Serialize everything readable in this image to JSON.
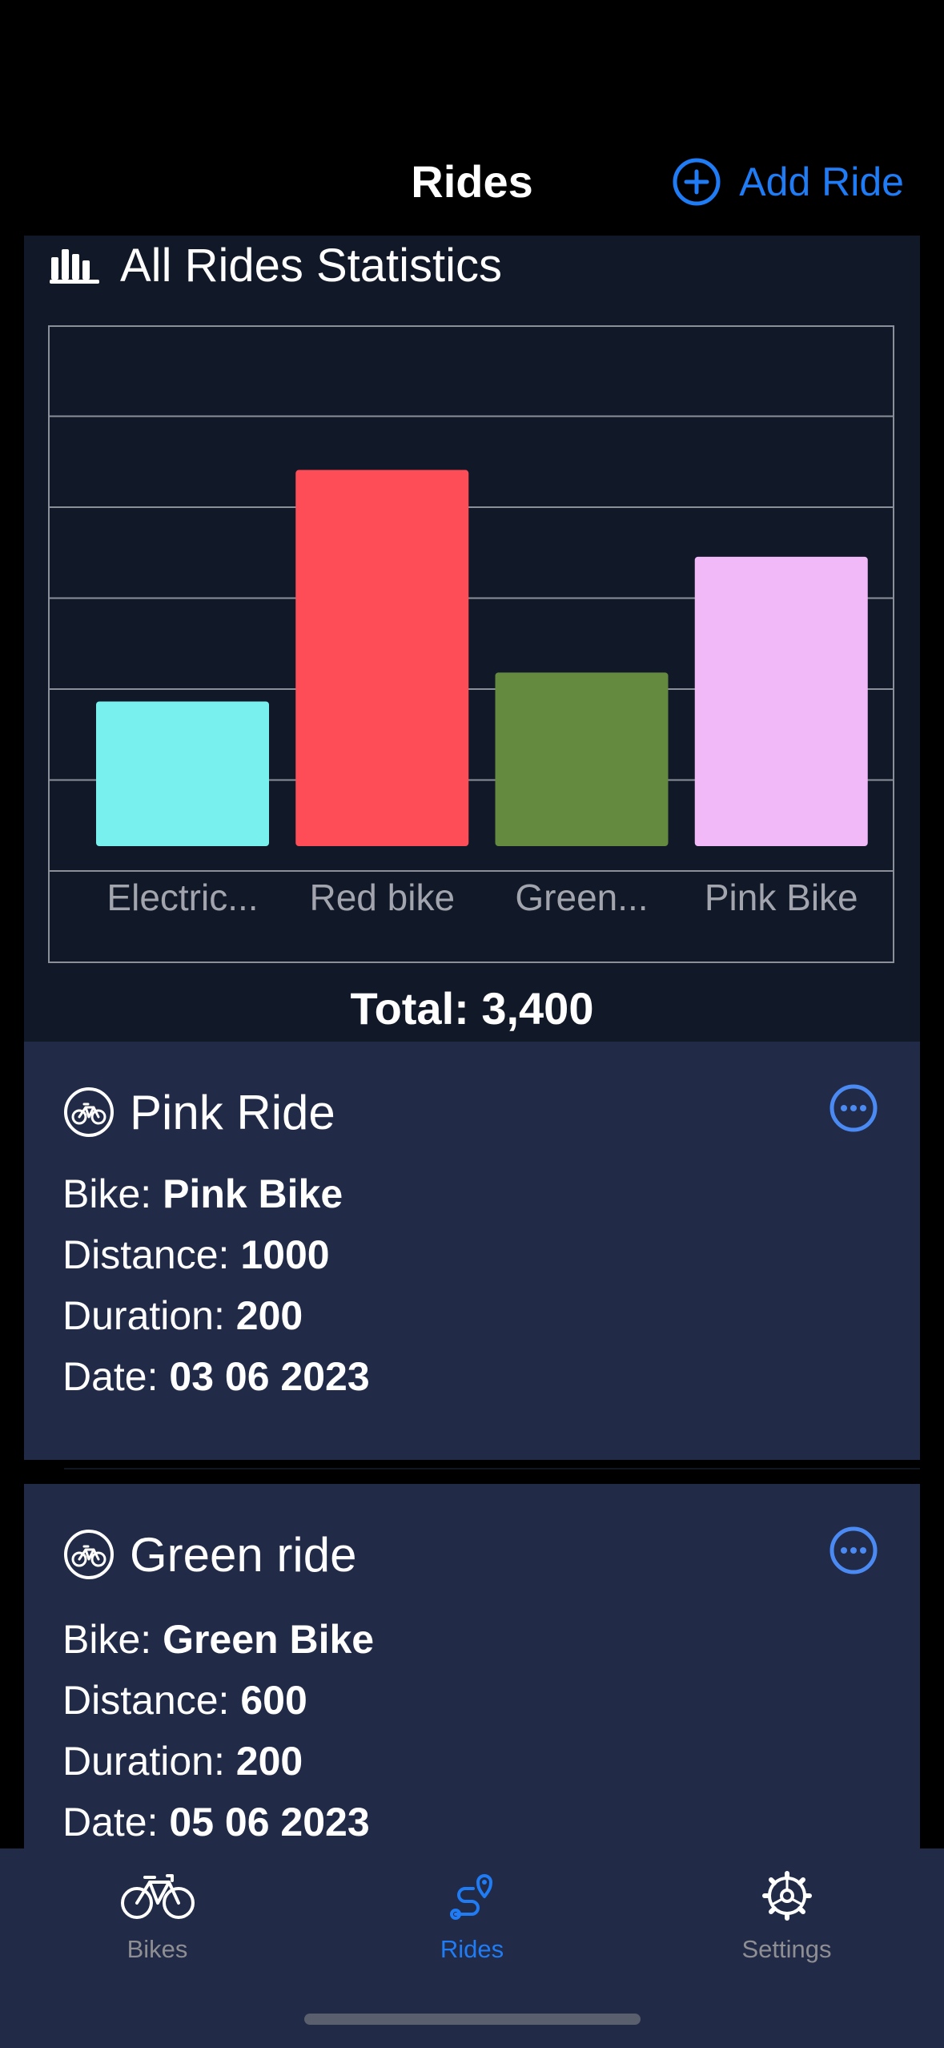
{
  "nav": {
    "title": "Rides",
    "add_label": "Add Ride"
  },
  "stats": {
    "title": "All Rides Statistics",
    "total": "Total: 3,400"
  },
  "chart_data": {
    "type": "bar",
    "categories": [
      "Electric...",
      "Red bike",
      "Green...",
      "Pink Bike"
    ],
    "values": [
      500,
      1300,
      600,
      1000
    ],
    "colors": [
      "#77f0ee",
      "#ff4d58",
      "#648a40",
      "#f2b9f9"
    ],
    "ylim": [
      0,
      1800
    ],
    "grid": true
  },
  "rides": [
    {
      "title": "Pink Ride",
      "bike_label": "Bike:",
      "bike": "Pink Bike",
      "distance_label": "Distance:",
      "distance": "1000",
      "duration_label": "Duration:",
      "duration": "200",
      "date_label": "Date:",
      "date": "03 06 2023"
    },
    {
      "title": "Green ride",
      "bike_label": "Bike:",
      "bike": "Green Bike",
      "distance_label": "Distance:",
      "distance": "600",
      "duration_label": "Duration:",
      "duration": "200",
      "date_label": "Date:",
      "date": "05 06 2023"
    }
  ],
  "tabs": [
    {
      "label": "Bikes",
      "icon": "bicycle-icon",
      "active": false
    },
    {
      "label": "Rides",
      "icon": "route-icon",
      "active": true
    },
    {
      "label": "Settings",
      "icon": "gear-icon",
      "active": false
    }
  ],
  "colors": {
    "accent": "#1f7cf5",
    "card": "#212a47",
    "panel": "#111827",
    "inactive": "#8e8e93"
  }
}
